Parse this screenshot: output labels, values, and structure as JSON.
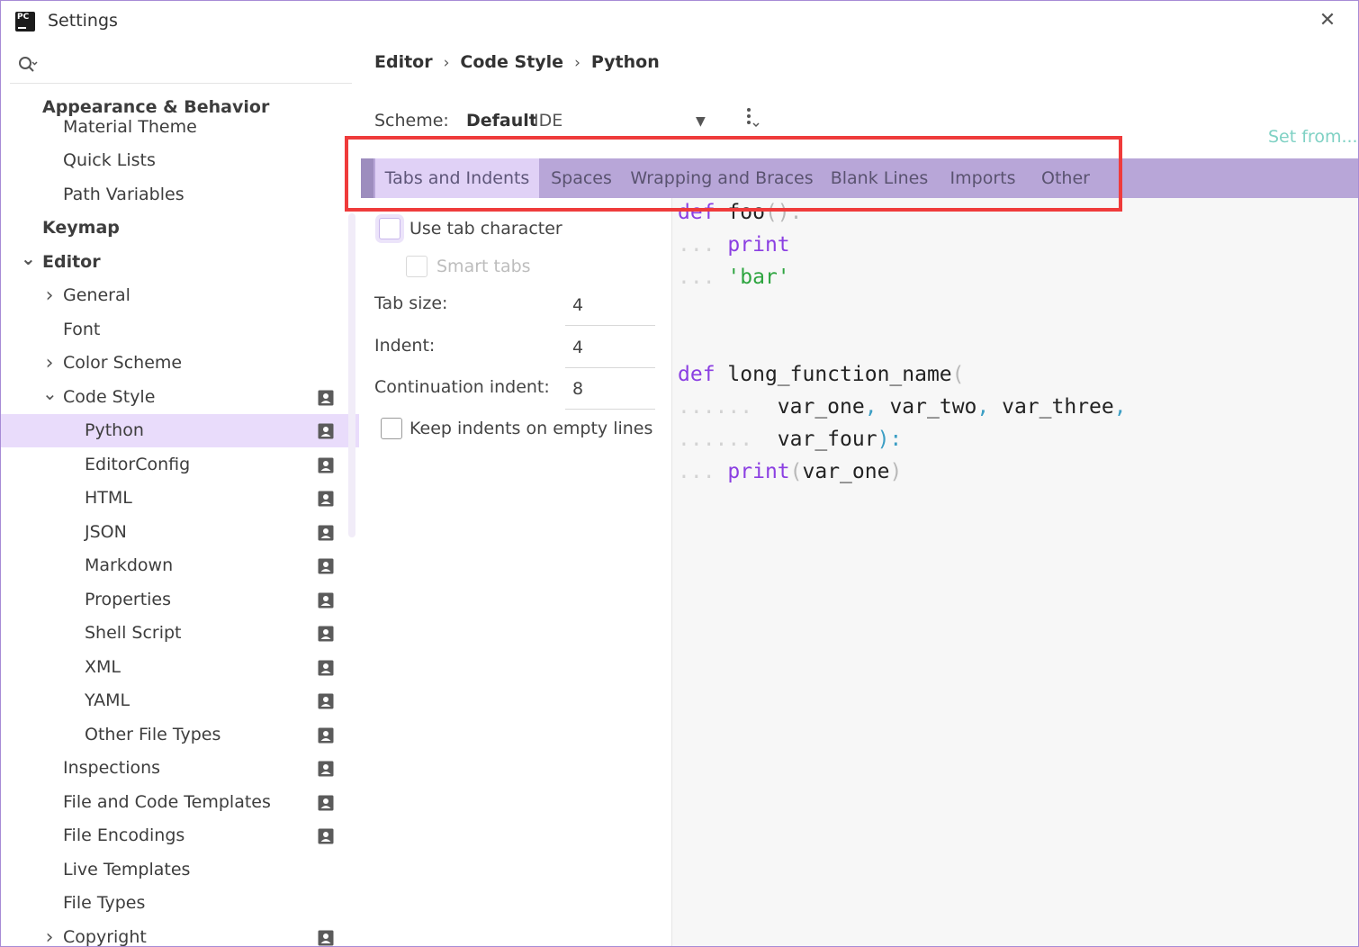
{
  "window": {
    "title": "Settings"
  },
  "sidebar": {
    "items": [
      {
        "label": "Appearance & Behavior",
        "bold": true,
        "level": 0
      },
      {
        "label": "Material Theme",
        "level": 1
      },
      {
        "label": "Quick Lists",
        "level": 1
      },
      {
        "label": "Path Variables",
        "level": 1
      },
      {
        "label": "Keymap",
        "bold": true,
        "level": 0
      },
      {
        "label": "Editor",
        "bold": true,
        "level": 0,
        "expanded": true
      },
      {
        "label": "General",
        "level": 1,
        "collapsed": true
      },
      {
        "label": "Font",
        "level": 1
      },
      {
        "label": "Color Scheme",
        "level": 1,
        "collapsed": true
      },
      {
        "label": "Code Style",
        "level": 1,
        "expanded": true,
        "project": true
      },
      {
        "label": "Python",
        "level": 2,
        "selected": true,
        "project": true
      },
      {
        "label": "EditorConfig",
        "level": 2,
        "project": true
      },
      {
        "label": "HTML",
        "level": 2,
        "project": true
      },
      {
        "label": "JSON",
        "level": 2,
        "project": true
      },
      {
        "label": "Markdown",
        "level": 2,
        "project": true
      },
      {
        "label": "Properties",
        "level": 2,
        "project": true
      },
      {
        "label": "Shell Script",
        "level": 2,
        "project": true
      },
      {
        "label": "XML",
        "level": 2,
        "project": true
      },
      {
        "label": "YAML",
        "level": 2,
        "project": true
      },
      {
        "label": "Other File Types",
        "level": 2,
        "project": true
      },
      {
        "label": "Inspections",
        "level": 1,
        "project": true
      },
      {
        "label": "File and Code Templates",
        "level": 1,
        "project": true
      },
      {
        "label": "File Encodings",
        "level": 1,
        "project": true
      },
      {
        "label": "Live Templates",
        "level": 1
      },
      {
        "label": "File Types",
        "level": 1
      },
      {
        "label": "Copyright",
        "level": 1,
        "collapsed": true,
        "project": true
      }
    ]
  },
  "breadcrumb": {
    "items": [
      "Editor",
      "Code Style",
      "Python"
    ]
  },
  "scheme": {
    "label": "Scheme:",
    "name": "Default",
    "type": "IDE"
  },
  "set_from": "Set from...",
  "tabs": [
    {
      "label": "Tabs and Indents",
      "active": true
    },
    {
      "label": "Spaces"
    },
    {
      "label": "Wrapping and Braces"
    },
    {
      "label": "Blank Lines"
    },
    {
      "label": "Imports"
    },
    {
      "label": "Other"
    }
  ],
  "options": {
    "use_tab_character": {
      "label": "Use tab character",
      "checked": false
    },
    "smart_tabs": {
      "label": "Smart tabs",
      "checked": false,
      "enabled": false
    },
    "tab_size": {
      "label": "Tab size:",
      "value": "4"
    },
    "indent": {
      "label": "Indent:",
      "value": "4"
    },
    "continuation_indent": {
      "label": "Continuation indent:",
      "value": "8"
    },
    "keep_indents": {
      "label": "Keep indents on empty lines",
      "checked": false
    }
  },
  "preview": {
    "line1": {
      "kw": "def",
      "name": "foo",
      "punct": "():"
    },
    "line2": {
      "ws": "...",
      "fn": "print"
    },
    "line3": {
      "ws": "...",
      "str": "'bar'"
    },
    "line4": {
      "kw": "def",
      "name": "long_function_name",
      "open": "("
    },
    "line5": {
      "ws": "......",
      "a": "var_one",
      "c1": ",",
      "b": "var_two",
      "c2": ",",
      "c": "var_three",
      "c3": ","
    },
    "line6": {
      "ws": "......",
      "d": "var_four",
      "close": "):"
    },
    "line7": {
      "ws": "...",
      "fn": "print",
      "open": "(",
      "arg": "var_one",
      "close": ")"
    }
  },
  "colors": {
    "accent_tab": "#b8a6d8",
    "selected_item": "#e9dcfb",
    "keyword": "#8b3fe2",
    "string": "#2ea540",
    "highlight_box": "#ef3b3b",
    "link": "#7fd1c4"
  },
  "icons": {
    "search": "search-icon",
    "close": "close-icon",
    "project": "project-scope-icon",
    "chevron_right": "chevron-right-icon",
    "chevron_down": "chevron-down-icon",
    "kebab": "more-vertical-icon",
    "dropdown": "dropdown-arrow-icon"
  }
}
